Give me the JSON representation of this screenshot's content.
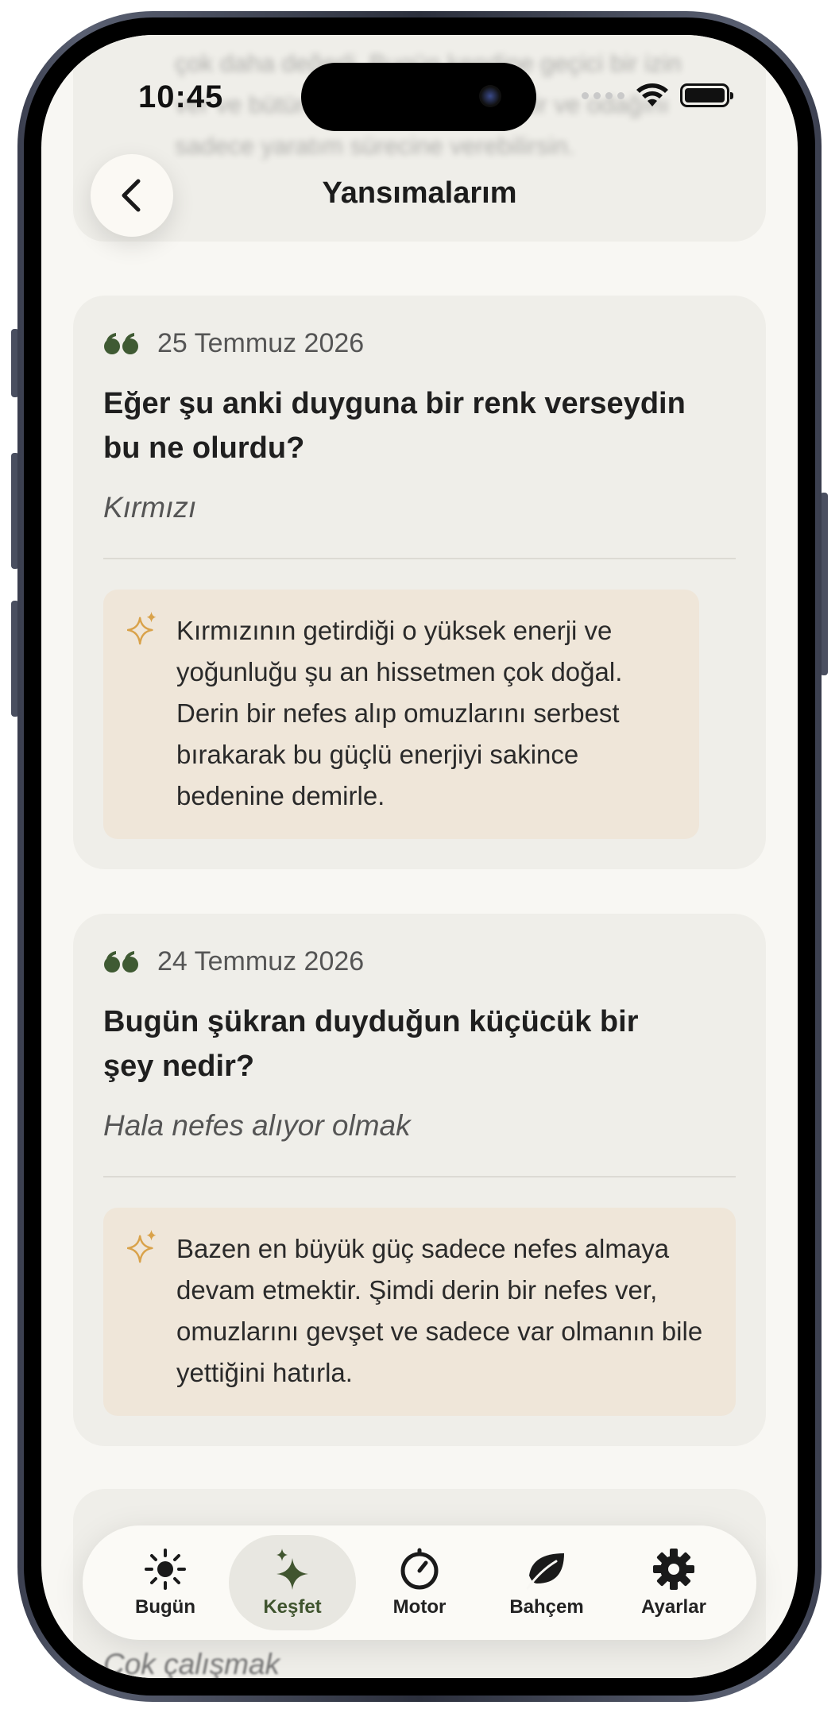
{
  "status_bar": {
    "time": "10:45"
  },
  "header": {
    "title": "Yansımalarım"
  },
  "ghost_text": "çok daha değerli. Bugün kendine geçici bir izin ver ve bütün yargıları rahatlatabilir ve odağını sadece yaratım sürecine verebilirsin.",
  "reflections": [
    {
      "date": "25 Temmuz 2026",
      "question": "Eğer şu anki duyguna bir renk verseydin bu ne olurdu?",
      "answer": "Kırmızı",
      "insight": "Kırmızının getirdiği o yüksek enerji ve yoğunluğu şu an hissetmen çok doğal. Derin bir nefes alıp omuzlarını serbest bırakarak bu güçlü enerjiyi sakince bedenine demirle."
    },
    {
      "date": "24 Temmuz 2026",
      "question": "Bugün şükran duyduğun küçücük bir şey nedir?",
      "answer": "Hala nefes alıyor olmak",
      "insight": "Bazen en büyük güç sadece nefes almaya devam etmektir. Şimdi derin bir nefes ver, omuzlarını gevşet ve sadece var olmanın bile yettiğini hatırla."
    }
  ],
  "partial_card": {
    "answer": "Çok çalışmak"
  },
  "tabbar": {
    "tabs": [
      {
        "label": "Bugün",
        "icon": "sun-icon"
      },
      {
        "label": "Keşfet",
        "icon": "sparkles-icon",
        "active": true
      },
      {
        "label": "Motor",
        "icon": "timer-icon"
      },
      {
        "label": "Bahçem",
        "icon": "leaf-icon"
      },
      {
        "label": "Ayarlar",
        "icon": "gear-icon"
      }
    ]
  },
  "colors": {
    "background": "#f8f7f3",
    "card": "#efeee9",
    "insight_box": "#efe6d9",
    "accent_green": "#40552f",
    "accent_gold": "#d9a24a"
  }
}
